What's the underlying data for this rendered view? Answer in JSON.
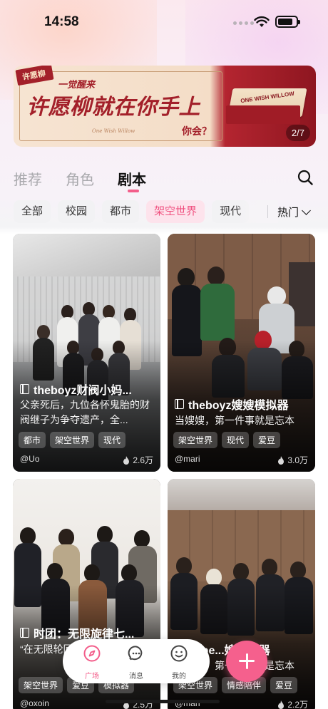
{
  "status_bar": {
    "time": "14:58"
  },
  "banner": {
    "tag": "许愿柳",
    "subtitle": "一觉醒来",
    "headline": "许愿柳就在你手上",
    "question": "你会？",
    "script": "One Wish Willow",
    "box_text": "ONE WISH WILLOW",
    "counter": "2/7"
  },
  "tabs": [
    {
      "label": "推荐",
      "active": false
    },
    {
      "label": "角色",
      "active": false
    },
    {
      "label": "剧本",
      "active": true
    }
  ],
  "filters": {
    "chips": [
      "全部",
      "校园",
      "都市",
      "架空世界",
      "现代"
    ],
    "active": "架空世界",
    "sort_label": "热门"
  },
  "cards": [
    {
      "title": "theboyz财阀小妈...",
      "description": "父亲死后，九位各怀鬼胎的财阀继子为争夺遗产，全...",
      "tags": [
        "都市",
        "架空世界",
        "现代"
      ],
      "author": "@Uo",
      "likes": "2.6万"
    },
    {
      "title": "theboyz嫂嫂模拟器",
      "description": "当嫂嫂，第一件事就是忘本",
      "tags": [
        "架空世界",
        "现代",
        "爱豆"
      ],
      "author": "@mari",
      "likes": "3.0万"
    },
    {
      "title": "时团：无限旋律七...",
      "description": "“在无限轮回...你必须把...",
      "tags": [
        "架空世界",
        "爱豆",
        "模拟器"
      ],
      "author": "@oxoin",
      "likes": "2.5万"
    },
    {
      "title": "hype...嫂模拟器",
      "description": "当嫂嫂，第一件事就是忘本",
      "tags": [
        "架空世界",
        "情感陪伴",
        "爱豆"
      ],
      "author": "@mari",
      "likes": "2.2万"
    }
  ],
  "nav": {
    "items": [
      {
        "label": "广场",
        "active": true
      },
      {
        "label": "消息",
        "active": false
      },
      {
        "label": "我的",
        "active": false
      }
    ]
  },
  "colors": {
    "accent": "#f35d8a",
    "banner_red": "#a3202a",
    "chip_bg": "#f2f2f4",
    "chip_active_bg": "#fde3ec"
  }
}
